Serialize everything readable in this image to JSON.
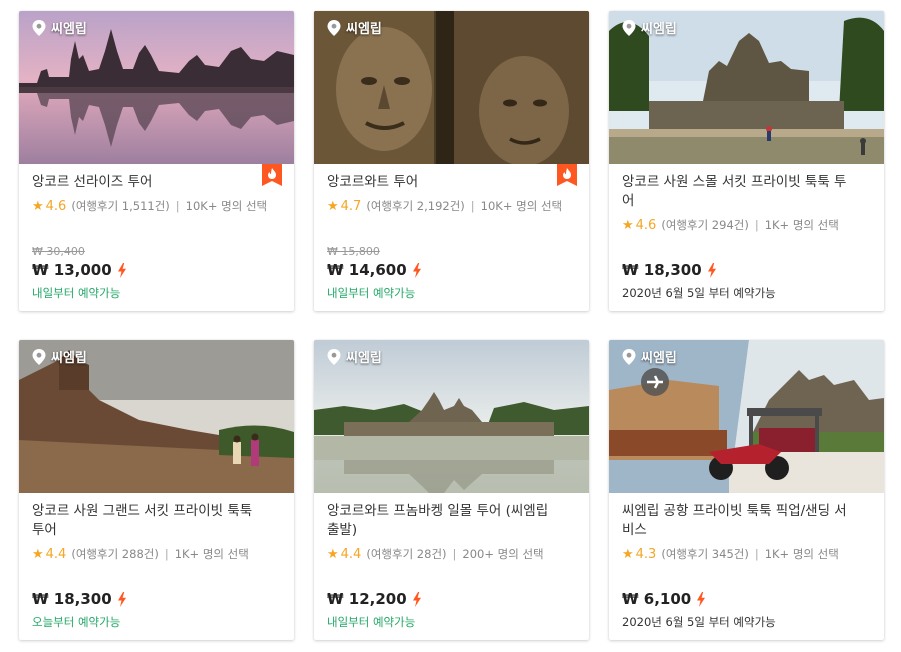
{
  "cards": [
    {
      "location": "씨엠립",
      "title": "앙코르 선라이즈 투어",
      "rating": "4.6",
      "reviews": "(여행후기 1,511건)",
      "selected": "10K+ 명의 선택",
      "old_price": "₩ 30,400",
      "price": "₩ 13,000",
      "availability": "내일부터 예약가능",
      "hot": true,
      "image": "angkor-sunrise"
    },
    {
      "location": "씨엠립",
      "title": "앙코르와트 투어",
      "rating": "4.7",
      "reviews": "(여행후기 2,192건)",
      "selected": "10K+ 명의 선택",
      "old_price": "₩ 15,800",
      "price": "₩ 14,600",
      "availability": "내일부터 예약가능",
      "hot": true,
      "image": "bayon-faces"
    },
    {
      "location": "씨엠립",
      "title": "앙코르 사원 스몰 서킷 프라이빗 툭툭 투어",
      "rating": "4.6",
      "reviews": "(여행후기 294건)",
      "selected": "1K+ 명의 선택",
      "old_price": "",
      "price": "₩ 18,300",
      "availability": "2020년 6월 5일 부터 예약가능",
      "hot": false,
      "image": "temple-grounds"
    },
    {
      "location": "씨엠립",
      "title": "앙코르 사원 그랜드 서킷 프라이빗 툭툭 투어",
      "rating": "4.4",
      "reviews": "(여행후기 288건)",
      "selected": "1K+ 명의 선택",
      "old_price": "",
      "price": "₩ 18,300",
      "availability": "오늘부터 예약가능",
      "hot": false,
      "image": "ruins-walkway"
    },
    {
      "location": "씨엠립",
      "title": "앙코르와트 프놈바켕 일몰 투어 (씨엠립 출발)",
      "rating": "4.4",
      "reviews": "(여행후기 28건)",
      "selected": "200+ 명의 선택",
      "old_price": "",
      "price": "₩ 12,200",
      "availability": "내일부터 예약가능",
      "hot": false,
      "image": "angkor-lake"
    },
    {
      "location": "씨엠립",
      "title": "씨엠립 공항 프라이빗 툭툭 픽업/샌딩 서비스",
      "rating": "4.3",
      "reviews": "(여행후기 345건)",
      "selected": "1K+ 명의 선택",
      "old_price": "",
      "price": "₩ 6,100",
      "availability": "2020년 6월 5일 부터 예약가능",
      "hot": false,
      "image": "airport-tuktuk"
    }
  ],
  "colors": {
    "accent": "#ff5722",
    "rating": "#f5a623",
    "available_green": "#24a868"
  }
}
